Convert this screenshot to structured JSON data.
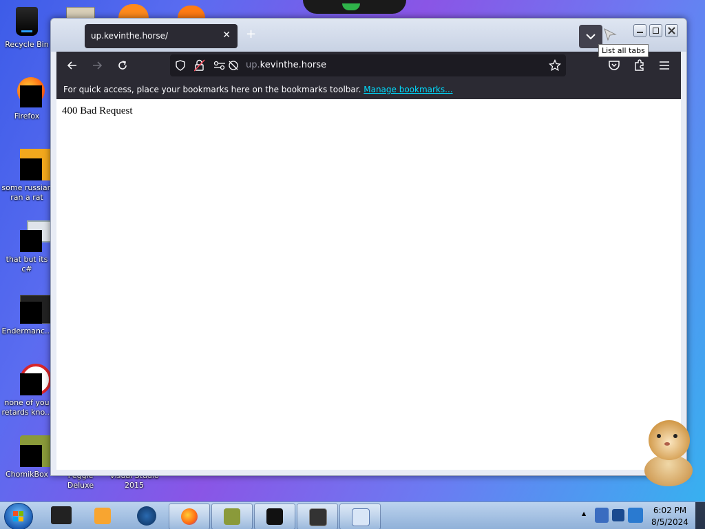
{
  "desktop": {
    "icons": [
      {
        "label": "Recycle Bin"
      },
      {
        "label": "Firefox"
      },
      {
        "label": "some russian ran a rat"
      },
      {
        "label": "that but its c#"
      },
      {
        "label": "Endermanc..."
      },
      {
        "label": "none of you retards kno..."
      },
      {
        "label": "ChomikBox"
      },
      {
        "label": "Peggle Deluxe"
      },
      {
        "label": "Visual Studio 2015"
      }
    ]
  },
  "browser": {
    "tab_title": "up.kevinthe.horse/",
    "tab_close": "✕",
    "new_tab": "+",
    "tooltip": "List all tabs",
    "url_prefix": "up.",
    "url_domain": "kevinthe.horse",
    "bookmarks_text": "For quick access, place your bookmarks here on the bookmarks toolbar.",
    "bookmarks_link": "Manage bookmarks...",
    "page_heading": "400 Bad Request"
  },
  "taskbar": {
    "time": "6:02 PM",
    "date": "8/5/2024",
    "tray_up": "▲"
  },
  "colors": {
    "toolbar": "#2b2a33",
    "accent_link": "#00ddff"
  }
}
